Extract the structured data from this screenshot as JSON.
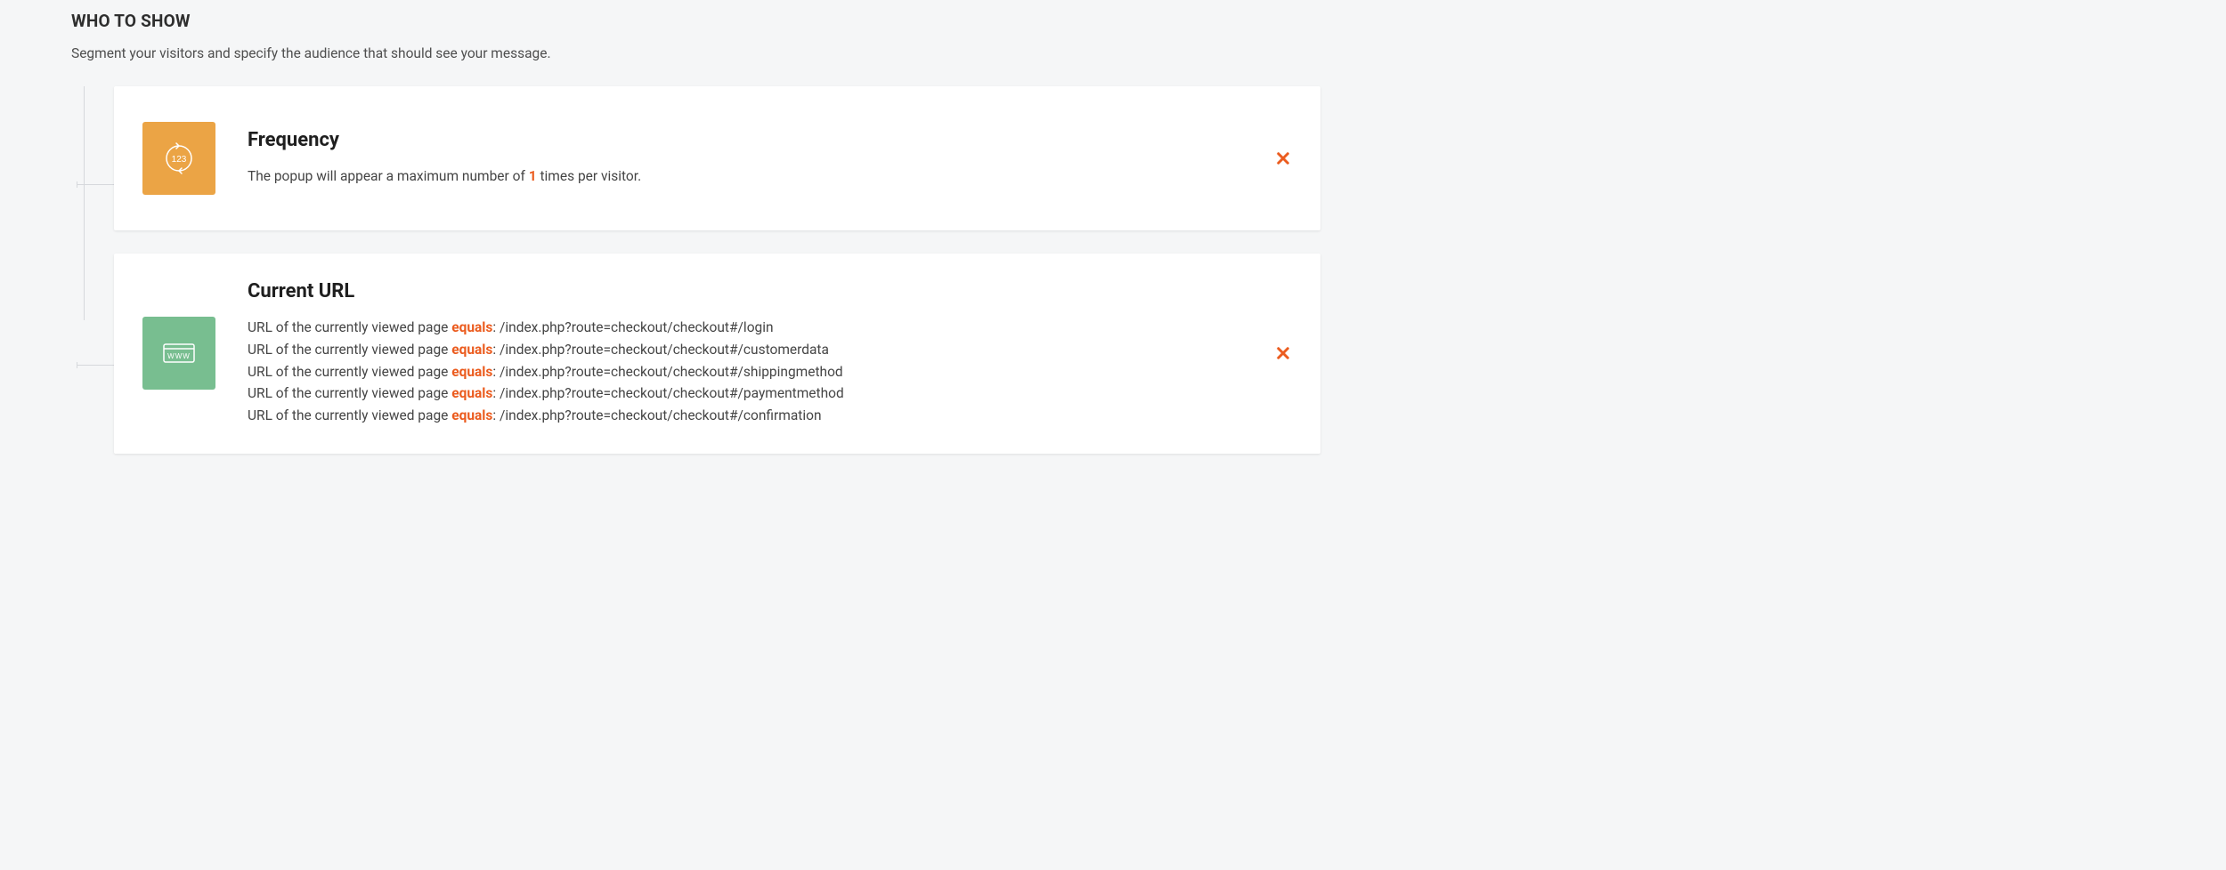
{
  "section": {
    "title": "WHO TO SHOW",
    "subtitle": "Segment your visitors and specify the audience that should see your message."
  },
  "rules": {
    "frequency": {
      "title": "Frequency",
      "prefix_text": "The popup will appear a maximum number of ",
      "count": "1",
      "suffix_text": " times per visitor."
    },
    "current_url": {
      "title": "Current URL",
      "line_prefix": "URL of the currently viewed page ",
      "operator": "equals",
      "items": [
        {
          "value": "/index.php?route=checkout/checkout#/login"
        },
        {
          "value": "/index.php?route=checkout/checkout#/customerdata"
        },
        {
          "value": "/index.php?route=checkout/checkout#/shippingmethod"
        },
        {
          "value": "/index.php?route=checkout/checkout#/paymentmethod"
        },
        {
          "value": "/index.php?route=checkout/checkout#/confirmation"
        }
      ]
    }
  }
}
